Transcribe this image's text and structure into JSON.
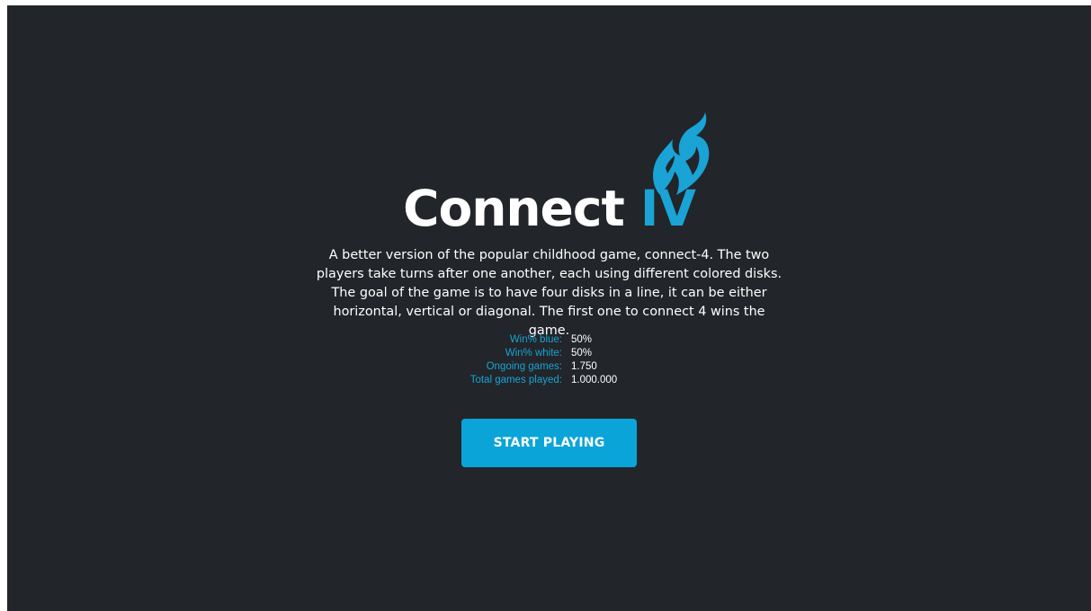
{
  "brand": {
    "title_main": "Connect",
    "title_accent": "IV",
    "accent_color": "#1aa3d5",
    "logo_icon": "flame-icon"
  },
  "description": "A better version of the popular childhood game, connect-4. The two players take turns after one another, each using different colored disks. The goal of the game is to have four disks in a line, it can be either horizontal, vertical or diagonal. The first one to connect 4 wins the game.",
  "stats": [
    {
      "label": "Win% blue:",
      "value": "50%"
    },
    {
      "label": "Win% white:",
      "value": "50%"
    },
    {
      "label": "Ongoing games:",
      "value": "1.750"
    },
    {
      "label": "Total games played:",
      "value": "1.000.000"
    }
  ],
  "actions": {
    "start_label": "START PLAYING"
  },
  "colors": {
    "background": "#222529",
    "button": "#0ba4d8",
    "text": "#ffffff"
  }
}
